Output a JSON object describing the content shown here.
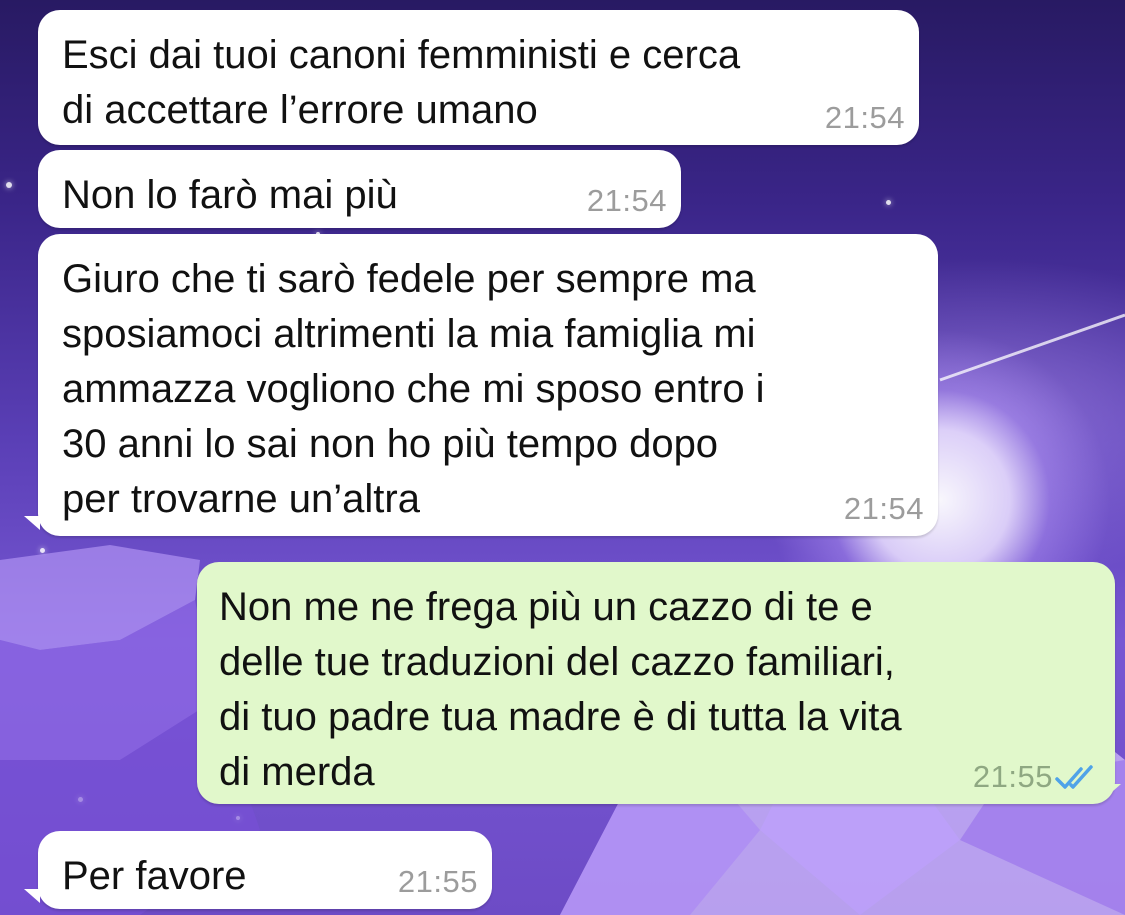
{
  "colors": {
    "incoming_bubble": "#ffffff",
    "outgoing_bubble": "#e1f8cb",
    "read_ticks": "#4fa3e8"
  },
  "messages": [
    {
      "direction": "incoming",
      "text": "Esci dai tuoi canoni femministi e cerca\ndi accettare l’errore umano",
      "time": "21:54"
    },
    {
      "direction": "incoming",
      "text": "Non lo farò mai più",
      "time": "21:54"
    },
    {
      "direction": "incoming",
      "text": "Giuro che ti sarò fedele per sempre ma\nsposiamoci altrimenti la mia famiglia mi\nammazza vogliono che mi sposo entro i\n30 anni lo sai non ho più tempo dopo\nper trovarne un’altra",
      "time": "21:54"
    },
    {
      "direction": "outgoing",
      "text": "Non me ne frega più un cazzo di te e\ndelle tue traduzioni del cazzo familiari,\ndi tuo padre tua madre è di tutta la vita\ndi merda",
      "time": "21:55",
      "status_icon": "double-check-read-icon"
    },
    {
      "direction": "incoming",
      "text": "Per favore",
      "time": "21:55"
    }
  ]
}
